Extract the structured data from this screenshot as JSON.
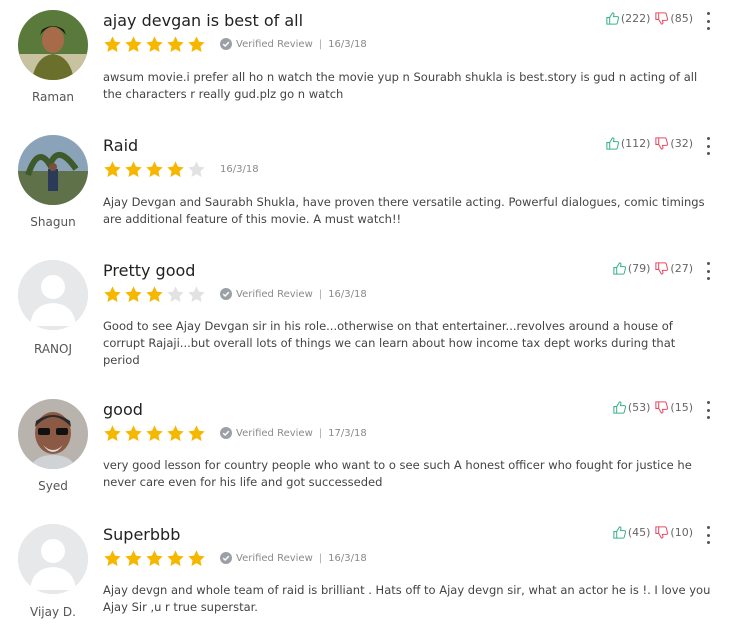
{
  "colors": {
    "star_filled": "#f6b700",
    "star_empty": "#e2e2e2",
    "thumb_up": "#3bb38e",
    "thumb_down": "#e44d65",
    "verified_check": "#9aa0a6"
  },
  "reviews": [
    {
      "user": "Raman",
      "title": "ajay devgan is best of all",
      "rating": 5,
      "verified": true,
      "verified_label": "Verified Review",
      "separator": "|",
      "date": "16/3/18",
      "body": "awsum movie.i prefer all ho n watch the movie yup n Sourabh shukla is best.story is gud n acting of all the characters r really gud.plz go n watch",
      "likes": "(222)",
      "dislikes": "(85)",
      "avatar": "photo"
    },
    {
      "user": "Shagun",
      "title": "Raid",
      "rating": 4,
      "verified": false,
      "date": "16/3/18",
      "body": "Ajay Devgan and Saurabh Shukla, have proven there versatile acting. Powerful dialogues, comic timings are additional feature of this movie. A must watch!!",
      "likes": "(112)",
      "dislikes": "(32)",
      "avatar": "photo"
    },
    {
      "user": "RANOJ",
      "title": "Pretty good",
      "rating": 3,
      "verified": true,
      "verified_label": "Verified Review",
      "separator": "|",
      "date": "16/3/18",
      "body": "Good to see Ajay Devgan sir in his role...otherwise on that entertainer...revolves around a house of corrupt Rajaji...but overall lots of things we can learn about how income tax dept works during that period",
      "likes": "(79)",
      "dislikes": "(27)",
      "avatar": "placeholder"
    },
    {
      "user": "Syed",
      "title": "good",
      "rating": 5,
      "verified": true,
      "verified_label": "Verified Review",
      "separator": "|",
      "date": "17/3/18",
      "body": "very good lesson for country people who want to o see such A honest officer who fought for justice he never care even for his life and got successeded",
      "likes": "(53)",
      "dislikes": "(15)",
      "avatar": "photo"
    },
    {
      "user": "Vijay D.",
      "title": "Superbbb",
      "rating": 5,
      "verified": true,
      "verified_label": "Verified Review",
      "separator": "|",
      "date": "16/3/18",
      "body": "Ajay devgn and whole team of raid is brilliant . Hats off to Ajay devgn sir, what an actor he is !. I love you Ajay Sir ,u r true superstar.",
      "likes": "(45)",
      "dislikes": "(10)",
      "avatar": "placeholder"
    }
  ]
}
